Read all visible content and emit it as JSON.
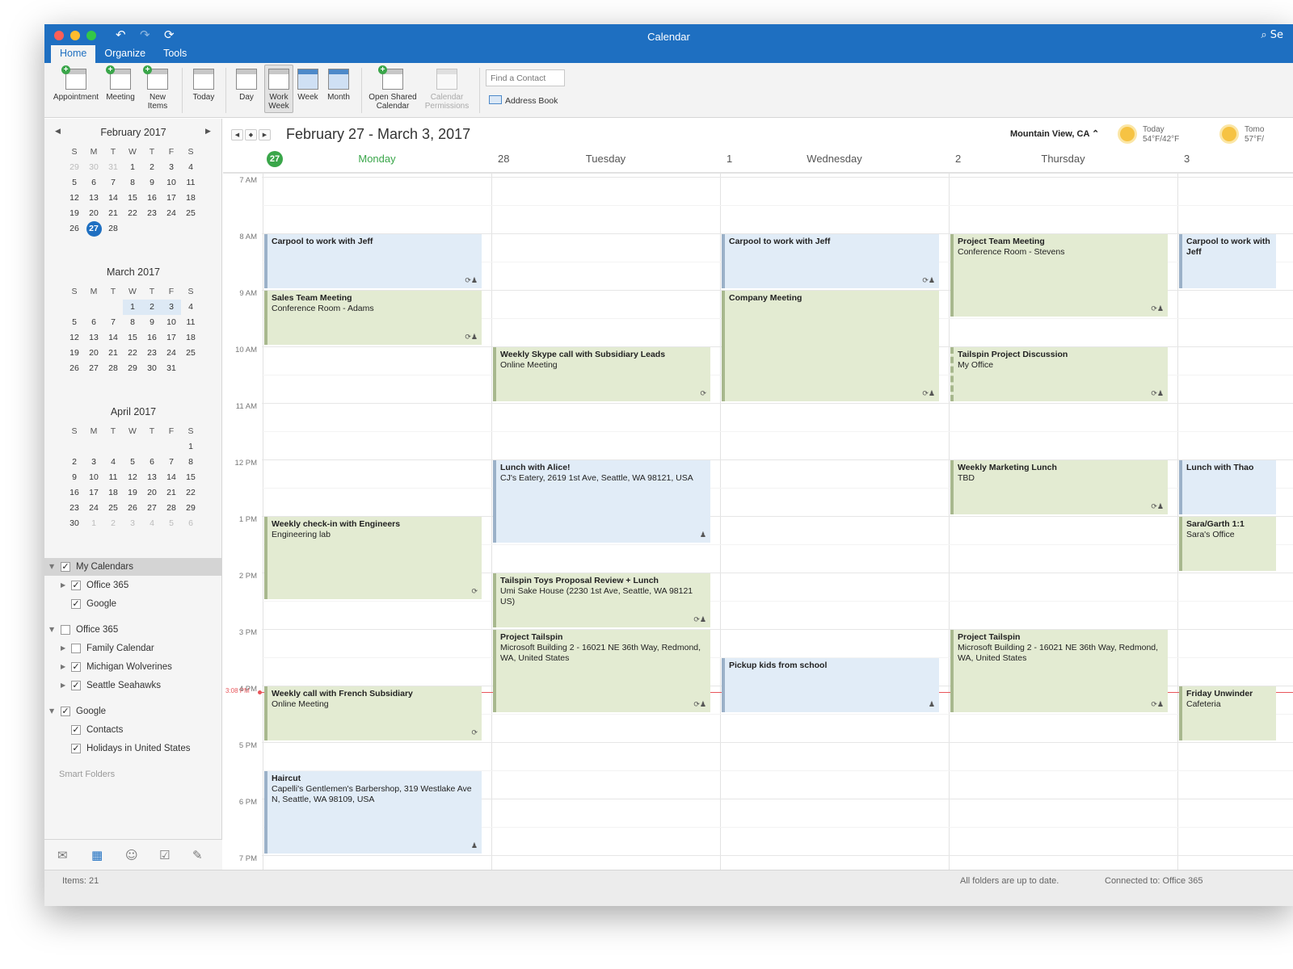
{
  "window": {
    "title": "Calendar",
    "search_placeholder": "Se",
    "tabs": [
      "Home",
      "Organize",
      "Tools"
    ]
  },
  "ribbon": {
    "appointment": "Appointment",
    "meeting": "Meeting",
    "new_items_1": "New",
    "new_items_2": "Items",
    "today": "Today",
    "day": "Day",
    "work_week_1": "Work",
    "work_week_2": "Week",
    "week": "Week",
    "month": "Month",
    "open_shared_1": "Open Shared",
    "open_shared_2": "Calendar",
    "perm_1": "Calendar",
    "perm_2": "Permissions",
    "find_contact_placeholder": "Find a Contact",
    "address_book": "Address Book"
  },
  "sidebar": {
    "feb": {
      "title": "February 2017",
      "dow": [
        "S",
        "M",
        "T",
        "W",
        "T",
        "F",
        "S"
      ],
      "rows": [
        [
          "29",
          "30",
          "31",
          "1",
          "2",
          "3",
          "4"
        ],
        [
          "5",
          "6",
          "7",
          "8",
          "9",
          "10",
          "11"
        ],
        [
          "12",
          "13",
          "14",
          "15",
          "16",
          "17",
          "18"
        ],
        [
          "19",
          "20",
          "21",
          "22",
          "23",
          "24",
          "25"
        ],
        [
          "26",
          "27",
          "28",
          "",
          "",
          "",
          ""
        ]
      ]
    },
    "mar": {
      "title": "March 2017",
      "dow": [
        "S",
        "M",
        "T",
        "W",
        "T",
        "F",
        "S"
      ],
      "rows": [
        [
          "",
          "",
          "",
          "1",
          "2",
          "3",
          "4"
        ],
        [
          "5",
          "6",
          "7",
          "8",
          "9",
          "10",
          "11"
        ],
        [
          "12",
          "13",
          "14",
          "15",
          "16",
          "17",
          "18"
        ],
        [
          "19",
          "20",
          "21",
          "22",
          "23",
          "24",
          "25"
        ],
        [
          "26",
          "27",
          "28",
          "29",
          "30",
          "31",
          ""
        ]
      ]
    },
    "apr": {
      "title": "April 2017",
      "dow": [
        "S",
        "M",
        "T",
        "W",
        "T",
        "F",
        "S"
      ],
      "rows": [
        [
          "",
          "",
          "",
          "",
          "",
          "",
          "1"
        ],
        [
          "2",
          "3",
          "4",
          "5",
          "6",
          "7",
          "8"
        ],
        [
          "9",
          "10",
          "11",
          "12",
          "13",
          "14",
          "15"
        ],
        [
          "16",
          "17",
          "18",
          "19",
          "20",
          "21",
          "22"
        ],
        [
          "23",
          "24",
          "25",
          "26",
          "27",
          "28",
          "29"
        ],
        [
          "30",
          "1",
          "2",
          "3",
          "4",
          "5",
          "6"
        ]
      ]
    },
    "calendars": {
      "my_calendars": "My Calendars",
      "office365_sub": "Office 365",
      "google_sub": "Google",
      "office365_group": "Office 365",
      "family": "Family Calendar",
      "michigan": "Michigan Wolverines",
      "seahawks": "Seattle Seahawks",
      "google_group": "Google",
      "contacts": "Contacts",
      "holidays": "Holidays in United States"
    },
    "smart_folders": "Smart Folders"
  },
  "main": {
    "range_title": "February 27 - March 3, 2017",
    "location": "Mountain View, CA",
    "weather_today_label": "Today",
    "weather_today_temp": "54°F/42°F",
    "weather_tomorrow_label": "Tomo",
    "weather_tomorrow_temp": "57°F/",
    "days": [
      {
        "num": "27",
        "name": "Monday"
      },
      {
        "num": "28",
        "name": "Tuesday"
      },
      {
        "num": "1",
        "name": "Wednesday"
      },
      {
        "num": "2",
        "name": "Thursday"
      },
      {
        "num": "3",
        "name": ""
      }
    ],
    "hours": [
      "7 AM",
      "8 AM",
      "9 AM",
      "10 AM",
      "11 AM",
      "12 PM",
      "1 PM",
      "2 PM",
      "3 PM",
      "4 PM",
      "5 PM",
      "6 PM",
      "7 PM"
    ],
    "now_label": "3:08 PM"
  },
  "events": [
    {
      "day": 0,
      "start": 8,
      "end": 9,
      "color": "blue",
      "title": "Carpool to work with Jeff",
      "loc": "",
      "badge": "⟳♟"
    },
    {
      "day": 0,
      "start": 9,
      "end": 10,
      "color": "green",
      "title": "Sales Team Meeting",
      "loc": "Conference Room - Adams",
      "badge": "⟳♟"
    },
    {
      "day": 0,
      "start": 13,
      "end": 14.5,
      "color": "green",
      "title": "Weekly check-in with Engineers",
      "loc": "Engineering lab",
      "badge": "⟳"
    },
    {
      "day": 0,
      "start": 16,
      "end": 17,
      "color": "green",
      "title": "Weekly call with French Subsidiary",
      "loc": "Online Meeting",
      "badge": "⟳"
    },
    {
      "day": 0,
      "start": 17.5,
      "end": 19,
      "color": "blue",
      "title": "Haircut",
      "loc": "Capelli's Gentlemen's Barbershop, 319 Westlake Ave N, Seattle, WA 98109, USA",
      "badge": "♟"
    },
    {
      "day": 1,
      "start": 10,
      "end": 11,
      "color": "green",
      "title": "Weekly Skype call with Subsidiary Leads",
      "loc": "Online Meeting",
      "badge": "⟳"
    },
    {
      "day": 1,
      "start": 12,
      "end": 13.5,
      "color": "blue",
      "title": "Lunch with Alice!",
      "loc": "CJ's Eatery, 2619 1st Ave, Seattle, WA 98121, USA",
      "badge": "♟"
    },
    {
      "day": 1,
      "start": 14,
      "end": 15,
      "color": "green",
      "title": "Tailspin Toys Proposal Review + Lunch",
      "loc": "Umi Sake House (2230 1st Ave, Seattle, WA 98121 US)",
      "badge": "⟳♟"
    },
    {
      "day": 1,
      "start": 15,
      "end": 16.5,
      "color": "green",
      "title": "Project Tailspin",
      "loc": "Microsoft Building 2 - 16021 NE 36th Way, Redmond, WA, United States",
      "badge": "⟳♟"
    },
    {
      "day": 2,
      "start": 8,
      "end": 9,
      "color": "blue",
      "title": "Carpool to work with Jeff",
      "loc": "",
      "badge": "⟳♟"
    },
    {
      "day": 2,
      "start": 9,
      "end": 11,
      "color": "green",
      "title": "Company Meeting",
      "loc": "",
      "badge": "⟳♟"
    },
    {
      "day": 2,
      "start": 15.5,
      "end": 16.5,
      "color": "blue",
      "title": "Pickup kids from school",
      "loc": "",
      "badge": "♟"
    },
    {
      "day": 3,
      "start": 8,
      "end": 9.5,
      "color": "green",
      "title": "Project Team Meeting",
      "loc": "Conference Room - Stevens",
      "badge": "⟳♟"
    },
    {
      "day": 3,
      "start": 10,
      "end": 11,
      "color": "green",
      "title": "Tailspin Project Discussion",
      "loc": "My Office",
      "badge": "⟳♟",
      "tentative": true
    },
    {
      "day": 3,
      "start": 12,
      "end": 13,
      "color": "green",
      "title": "Weekly Marketing Lunch",
      "loc": "TBD",
      "badge": "⟳♟"
    },
    {
      "day": 3,
      "start": 15,
      "end": 16.5,
      "color": "green",
      "title": "Project Tailspin",
      "loc": "Microsoft Building 2 - 16021 NE 36th Way, Redmond, WA, United States",
      "badge": "⟳♟"
    },
    {
      "day": 4,
      "start": 8,
      "end": 9,
      "color": "blue",
      "title": "Carpool to work with Jeff",
      "loc": "",
      "badge": ""
    },
    {
      "day": 4,
      "start": 12,
      "end": 13,
      "color": "blue",
      "title": "Lunch with Thao",
      "loc": "",
      "badge": ""
    },
    {
      "day": 4,
      "start": 13,
      "end": 14,
      "color": "green",
      "title": "Sara/Garth 1:1",
      "loc": "Sara's Office",
      "badge": ""
    },
    {
      "day": 4,
      "start": 16,
      "end": 17,
      "color": "green",
      "title": "Friday Unwinder",
      "loc": "Cafeteria",
      "badge": ""
    }
  ],
  "statusbar": {
    "items": "Items: 21",
    "sync": "All folders are up to date.",
    "connected": "Connected to: Office 365"
  },
  "colors": {
    "accent": "#1e6fc1",
    "event_green": "#e3ebd2",
    "event_blue": "#e1ecf7",
    "today_green": "#3aa64a",
    "now_red": "#e8555a"
  }
}
